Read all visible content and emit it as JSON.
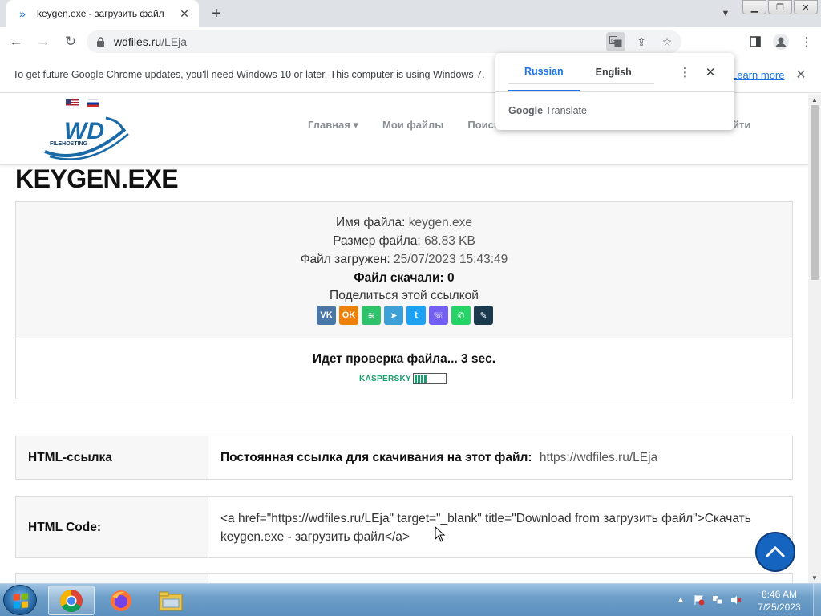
{
  "browser": {
    "tab_title": "keygen.exe - загрузить файл",
    "url_host": "wdfiles.ru",
    "url_path": "/LEja"
  },
  "infobar": {
    "text": "To get future Google Chrome updates, you'll need Windows 10 or later. This computer is using Windows 7.",
    "link": "Learn more"
  },
  "translate_popup": {
    "tabs": [
      "Russian",
      "English"
    ],
    "active_tab": "Russian",
    "brand_google": "Google",
    "brand_translate": "Translate"
  },
  "site": {
    "logo_text": "WD",
    "logo_subtext": "FILEHOSTING",
    "nav": [
      "Главная ▾",
      "Мои файлы",
      "Поиск"
    ],
    "nav_tail": "йти"
  },
  "file": {
    "title": "KEYGEN.EXE",
    "name_label": "Имя файла:",
    "name_value": "keygen.exe",
    "size_label": "Размер файла:",
    "size_value": "68.83 KB",
    "uploaded_label": "Файл загружен:",
    "uploaded_value": "25/07/2023 15:43:49",
    "downloads": "Файл скачали: 0",
    "share": "Поделиться этой ссылкой",
    "social": [
      {
        "name": "vk",
        "glyph": "VK",
        "color": "#4a76a8"
      },
      {
        "name": "odnoklassniki",
        "glyph": "OK",
        "color": "#ee8208"
      },
      {
        "name": "mail-agent",
        "glyph": "≋",
        "color": "#2fc26b"
      },
      {
        "name": "telegram",
        "glyph": "➤",
        "color": "#3ea0d6"
      },
      {
        "name": "twitter",
        "glyph": "t",
        "color": "#1da1f2"
      },
      {
        "name": "viber",
        "glyph": "☏",
        "color": "#7360f2"
      },
      {
        "name": "whatsapp",
        "glyph": "✆",
        "color": "#25d366"
      },
      {
        "name": "livejournal",
        "glyph": "✎",
        "color": "#1c3a4e"
      }
    ],
    "checking": "Идет проверка файла... 3 sec.",
    "kaspersky_text": "KASPERSKY",
    "scan_progress": 0.4
  },
  "links": {
    "html_link_label": "HTML-ссылка",
    "html_link_bold": "Постоянная ссылка для скачивания на этот файл:",
    "html_link_url": "https://wdfiles.ru/LEja",
    "html_code_label": "HTML Code:",
    "html_code_value": "<a href=\"https://wdfiles.ru/LEja\" target=\"_blank\" title=\"Download from загрузить файл\">Скачать keygen.exe - загрузить файл</a>"
  },
  "taskbar": {
    "time": "8:46 AM",
    "date": "7/25/2023"
  }
}
